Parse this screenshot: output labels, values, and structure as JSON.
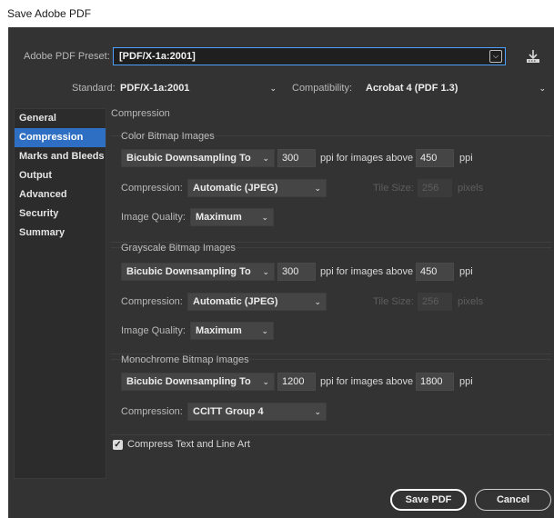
{
  "window": {
    "title": "Save Adobe PDF"
  },
  "preset": {
    "label": "Adobe PDF Preset:",
    "value": "[PDF/X-1a:2001]"
  },
  "standard": {
    "label": "Standard:",
    "value": "PDF/X-1a:2001"
  },
  "compatibility": {
    "label": "Compatibility:",
    "value": "Acrobat 4 (PDF 1.3)"
  },
  "sidebar": {
    "items": [
      {
        "label": "General"
      },
      {
        "label": "Compression"
      },
      {
        "label": "Marks and Bleeds"
      },
      {
        "label": "Output"
      },
      {
        "label": "Advanced"
      },
      {
        "label": "Security"
      },
      {
        "label": "Summary"
      }
    ],
    "active_index": 1
  },
  "compression": {
    "section_title": "Compression",
    "color": {
      "title": "Color Bitmap Images",
      "sampling": "Bicubic Downsampling To",
      "ppi": "300",
      "above_label": "ppi for images above",
      "above_value": "450",
      "ppi_unit": "ppi",
      "compression_label": "Compression:",
      "compression_value": "Automatic (JPEG)",
      "tile_label": "Tile Size:",
      "tile_value": "256",
      "tile_unit": "pixels",
      "quality_label": "Image Quality:",
      "quality_value": "Maximum"
    },
    "grayscale": {
      "title": "Grayscale Bitmap Images",
      "sampling": "Bicubic Downsampling To",
      "ppi": "300",
      "above_label": "ppi for images above",
      "above_value": "450",
      "ppi_unit": "ppi",
      "compression_label": "Compression:",
      "compression_value": "Automatic (JPEG)",
      "tile_label": "Tile Size:",
      "tile_value": "256",
      "tile_unit": "pixels",
      "quality_label": "Image Quality:",
      "quality_value": "Maximum"
    },
    "monochrome": {
      "title": "Monochrome Bitmap Images",
      "sampling": "Bicubic Downsampling To",
      "ppi": "1200",
      "above_label": "ppi for images above",
      "above_value": "1800",
      "ppi_unit": "ppi",
      "compression_label": "Compression:",
      "compression_value": "CCITT Group 4"
    },
    "compress_text": {
      "label": "Compress Text and Line Art",
      "checked": true
    }
  },
  "buttons": {
    "save": "Save PDF",
    "cancel": "Cancel"
  },
  "icons": {
    "chevron": "chevron-down-icon",
    "import": "import-preset-icon",
    "check": "checkmark-icon"
  },
  "colors": {
    "dialog_bg": "#333333",
    "selection": "#2e6fc3",
    "focus_border": "#4ea2ff"
  }
}
